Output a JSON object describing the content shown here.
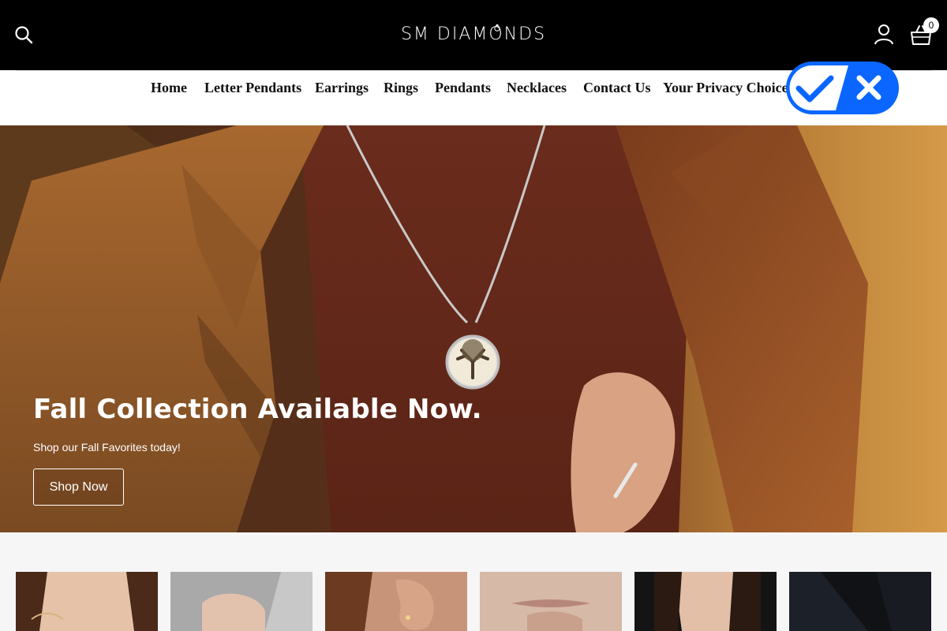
{
  "header": {
    "logo": "SM DIAMONDS",
    "search_icon": "search-icon",
    "account_icon": "user-icon",
    "cart_icon": "shopping-bag-icon",
    "cart_count": "0"
  },
  "nav": {
    "items": [
      {
        "label": "Home"
      },
      {
        "label": "Letter Pendants"
      },
      {
        "label": "Earrings"
      },
      {
        "label": "Rings"
      },
      {
        "label": "Pendants"
      },
      {
        "label": "Necklaces"
      },
      {
        "label": "Contact Us"
      },
      {
        "label": "Your Privacy Choices"
      }
    ],
    "privacy_icon": "check-x-toggle-icon"
  },
  "hero": {
    "title": "Fall Collection Available Now.",
    "subtitle": "Shop our Fall Favorites today!",
    "button": "Shop Now"
  },
  "categories": {
    "tiles": [
      {
        "image": "model-ring-hand"
      },
      {
        "image": "hand-on-sweater"
      },
      {
        "image": "ear-earring"
      },
      {
        "image": "chin-hand"
      },
      {
        "image": "model-necklace"
      },
      {
        "image": "dark-jacket"
      }
    ]
  },
  "colors": {
    "header_bg": "#000000",
    "nav_bg": "#ffffff",
    "privacy_blue": "#0a66ff"
  }
}
